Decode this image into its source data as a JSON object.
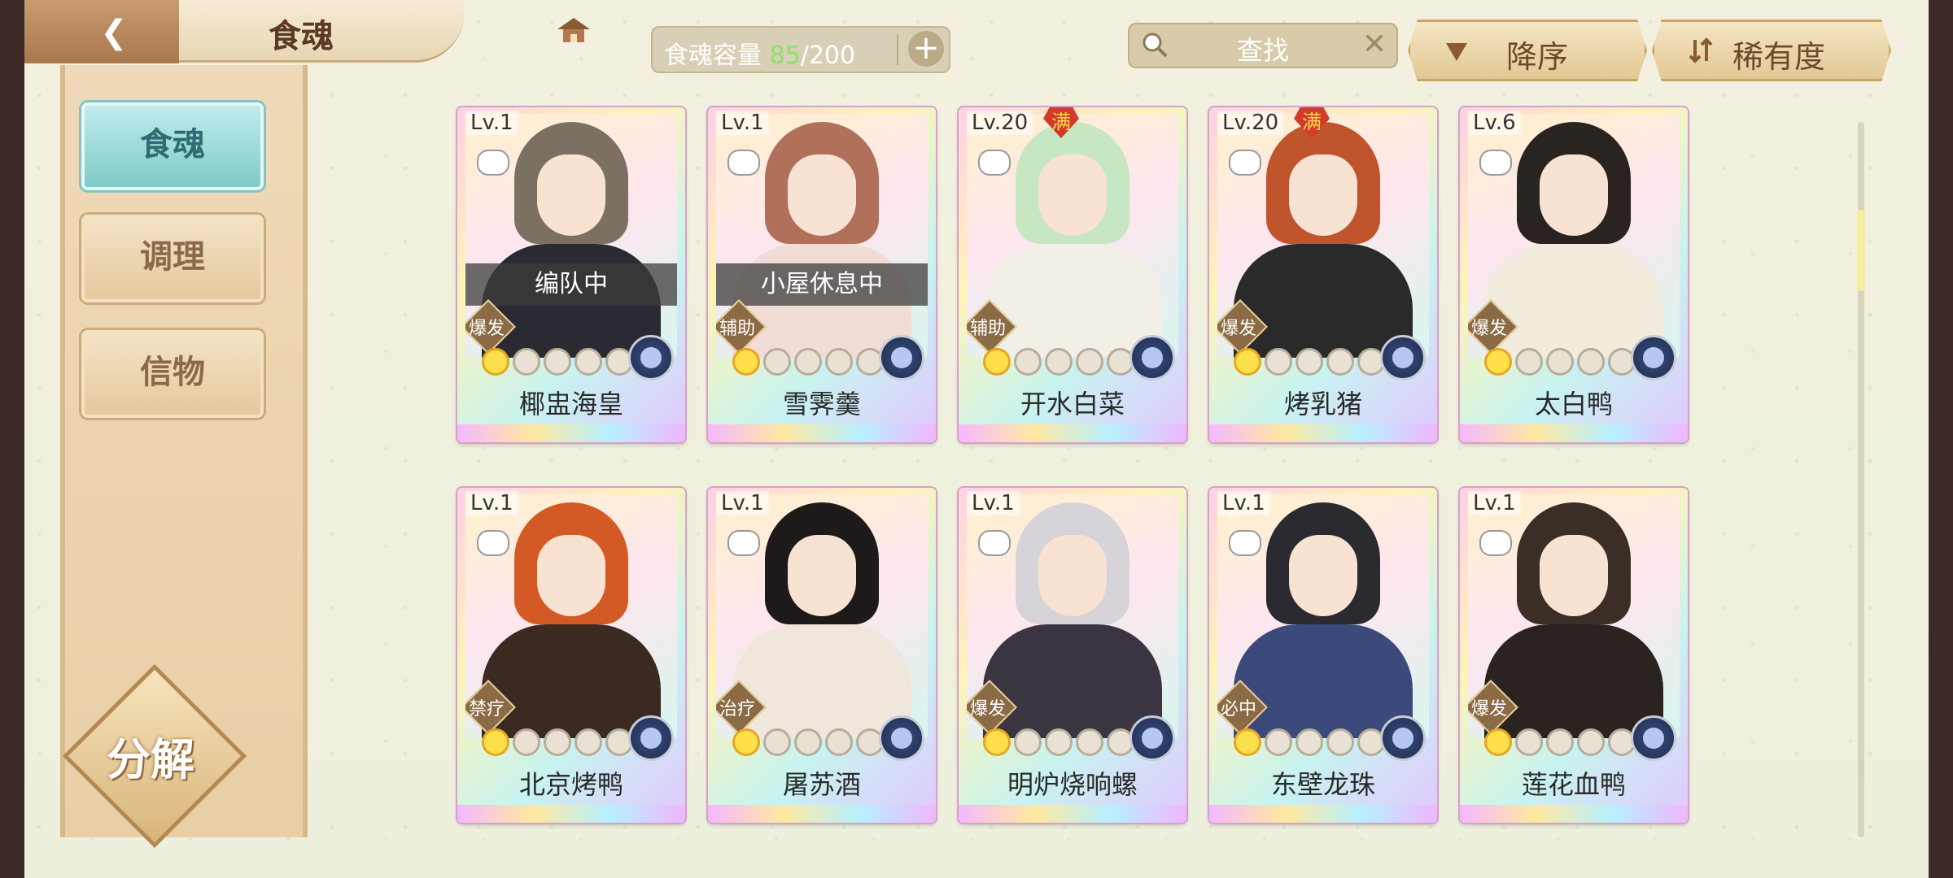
{
  "header": {
    "title": "食魂",
    "capacity_label": "食魂容量",
    "capacity_current": "85",
    "capacity_max": "/200",
    "capacity_add": "+",
    "search_label": "查找",
    "search_clear": "✕",
    "sort_order_label": "降序",
    "sort_rarity_label": "稀有度"
  },
  "sidebar": {
    "tabs": [
      {
        "label": "食魂",
        "active": true
      },
      {
        "label": "调理",
        "active": false
      },
      {
        "label": "信物",
        "active": false
      }
    ],
    "decompose_label": "分解"
  },
  "cards": [
    {
      "level": "Lv.1",
      "full": false,
      "status": "编队中",
      "role": "爆发",
      "stars": 1,
      "name": "椰盅海皇",
      "hair": "#7b7062",
      "outfit": "#2a2a33"
    },
    {
      "level": "Lv.1",
      "full": false,
      "status": "小屋休息中",
      "role": "辅助",
      "stars": 1,
      "name": "雪霁羹",
      "hair": "#b0705a",
      "outfit": "#f1dcd6"
    },
    {
      "level": "Lv.20",
      "full": true,
      "full_label": "满",
      "status": "",
      "role": "辅助",
      "stars": 1,
      "name": "开水白菜",
      "hair": "#c7e6c2",
      "outfit": "#f2f0e6"
    },
    {
      "level": "Lv.20",
      "full": true,
      "full_label": "满",
      "status": "",
      "role": "爆发",
      "stars": 1,
      "name": "烤乳猪",
      "hair": "#c0542c",
      "outfit": "#2a2a2a"
    },
    {
      "level": "Lv.6",
      "full": false,
      "status": "",
      "role": "爆发",
      "stars": 1,
      "name": "太白鸭",
      "hair": "#2a2420",
      "outfit": "#f2ecdf"
    },
    {
      "level": "Lv.1",
      "full": false,
      "status": "",
      "role": "禁疗",
      "stars": 1,
      "name": "北京烤鸭",
      "hair": "#d35a25",
      "outfit": "#3a2a22"
    },
    {
      "level": "Lv.1",
      "full": false,
      "status": "",
      "role": "治疗",
      "stars": 1,
      "name": "屠苏酒",
      "hair": "#1f1a1a",
      "outfit": "#f0e6dc"
    },
    {
      "level": "Lv.1",
      "full": false,
      "status": "",
      "role": "爆发",
      "stars": 1,
      "name": "明炉烧响螺",
      "hair": "#d6d4d8",
      "outfit": "#3a3540"
    },
    {
      "level": "Lv.1",
      "full": false,
      "status": "",
      "role": "必中",
      "stars": 1,
      "name": "东壁龙珠",
      "hair": "#2a2a30",
      "outfit": "#3b4a7a"
    },
    {
      "level": "Lv.1",
      "full": false,
      "status": "",
      "role": "爆发",
      "stars": 1,
      "name": "莲花血鸭",
      "hair": "#3a2e26",
      "outfit": "#2a2320"
    }
  ],
  "scroll": {
    "position": 0.12
  },
  "colors": {
    "active_tab": "#7ecbc7",
    "capacity_current": "#8ee06a",
    "full_badge": "#d23a2a"
  }
}
